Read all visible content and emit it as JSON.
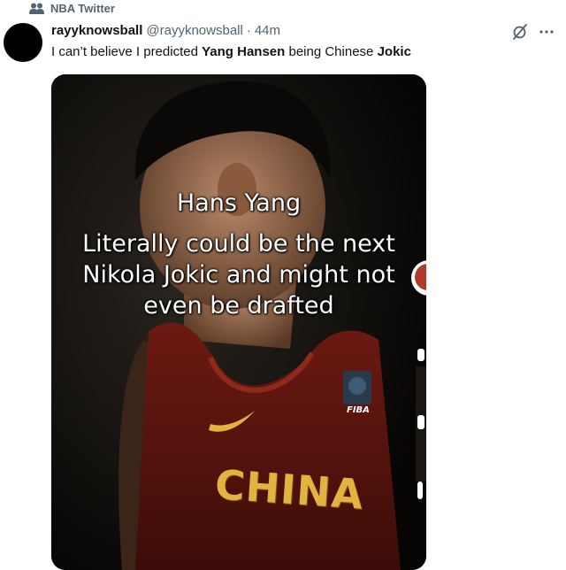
{
  "social_context": {
    "icon": "people-icon",
    "label": "NBA Twitter"
  },
  "tweet": {
    "display_name": "rayyknowsball",
    "handle": "@rayyknowsball",
    "separator": "·",
    "time": "44m",
    "text_parts": [
      {
        "text": "I can’t believe I predicted ",
        "bold": false
      },
      {
        "text": "Yang Hansen",
        "bold": true
      },
      {
        "text": " being Chinese ",
        "bold": false
      },
      {
        "text": "Jokic",
        "bold": true
      }
    ]
  },
  "header_icons": [
    "grok-icon",
    "more-icon"
  ],
  "media": {
    "caption": {
      "line1": "Hans Yang",
      "line2": "Literally could be the next",
      "line3": "Nikola Jokic and might not",
      "line4": "even be drafted"
    },
    "jersey_text": "CHINA",
    "badge_text": "FIBA",
    "colors": {
      "jersey": "#7a1d14",
      "trim": "#e2b33e",
      "background": "#0a0907"
    }
  }
}
